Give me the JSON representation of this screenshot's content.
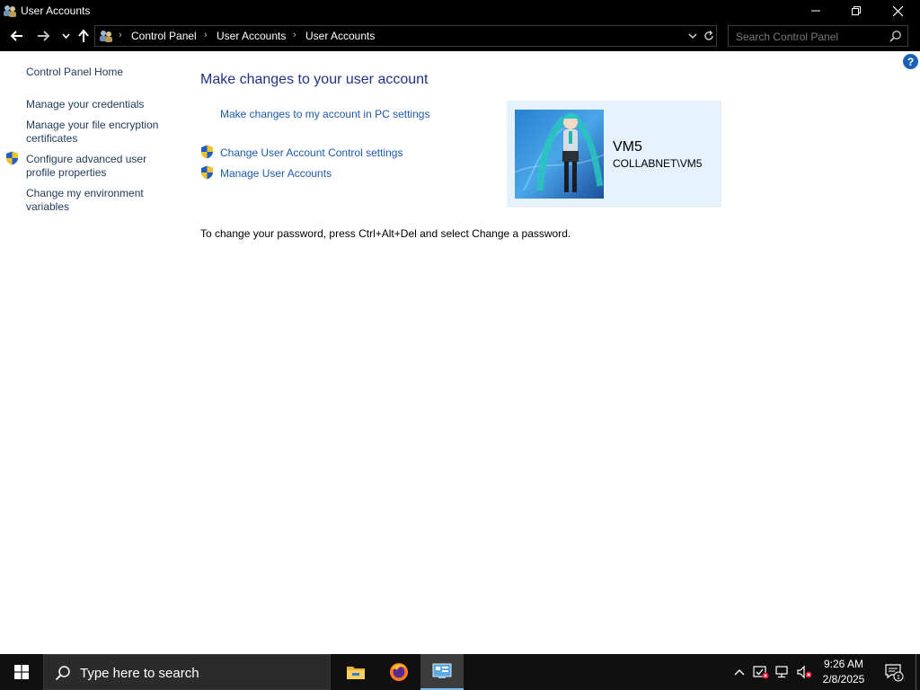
{
  "window": {
    "title": "User Accounts"
  },
  "address": {
    "crumbs": [
      "Control Panel",
      "User Accounts",
      "User Accounts"
    ],
    "search_placeholder": "Search Control Panel"
  },
  "help_label": "?",
  "left_nav": {
    "home": "Control Panel Home",
    "credentials": "Manage your credentials",
    "encryption_line1": "Manage your file encryption",
    "encryption_line2": "certificates",
    "advanced_line1": "Configure advanced user",
    "advanced_line2": "profile properties",
    "env_line1": "Change my environment",
    "env_line2": "variables"
  },
  "main": {
    "heading": "Make changes to your user account",
    "pc_settings_link": "Make changes to my account in PC settings",
    "uac_link": "Change User Account Control settings",
    "manage_link": "Manage User Accounts",
    "password_info": "To change your password, press Ctrl+Alt+Del and select Change a password."
  },
  "user": {
    "name": "VM5",
    "domain": "COLLABNET\\VM5"
  },
  "taskbar": {
    "search_placeholder": "Type here to search",
    "time": "9:26 AM",
    "date": "2/8/2025",
    "notification_count": "1"
  },
  "colors": {
    "link": "#1d5aab",
    "heading": "#1e3287",
    "tile_bg": "#e5f1fb",
    "titlebar": "#000000",
    "taskbar": "#101010"
  }
}
